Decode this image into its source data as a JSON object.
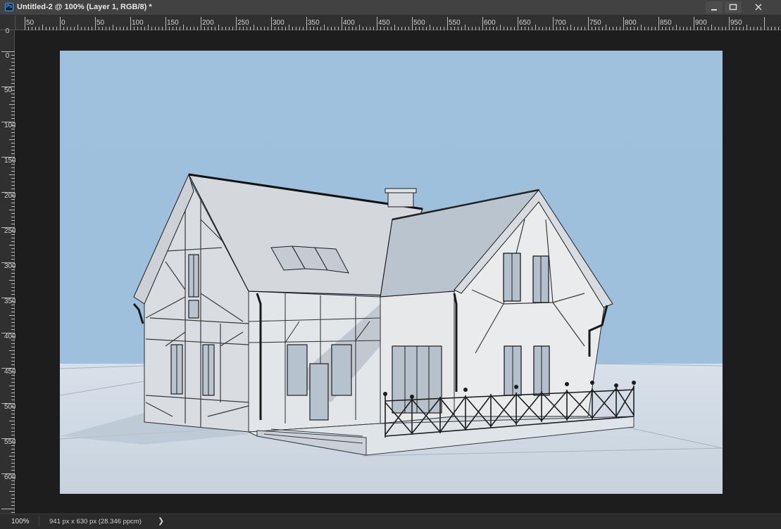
{
  "window": {
    "app_icon_label": "Ps",
    "title": "Untitled-2 @ 100% (Layer 1, RGB/8) *",
    "controls": [
      "minimize",
      "maximize",
      "close"
    ]
  },
  "ruler": {
    "top_labels": [
      "50",
      "0",
      "50",
      "100",
      "150",
      "200",
      "250",
      "300",
      "350",
      "400",
      "450",
      "500",
      "550",
      "600",
      "650",
      "700",
      "750",
      "800",
      "850",
      "900",
      "950"
    ],
    "left_labels": [
      "0",
      "0",
      "50",
      "100",
      "150",
      "200",
      "250",
      "300",
      "350",
      "400",
      "450",
      "500",
      "550",
      "600"
    ]
  },
  "document": {
    "image_content": "3D render of a two-storey half-timbered house with gabled roofs, dormer windows, chimney and a railed front terrace against a light blue sky",
    "sky_color": "#9cbfdc",
    "ground_color": "#cfd8e2"
  },
  "status": {
    "zoom": "100%",
    "doc_info": "941 px x 630 px (28.346 ppcm)",
    "arrow": "❯"
  }
}
